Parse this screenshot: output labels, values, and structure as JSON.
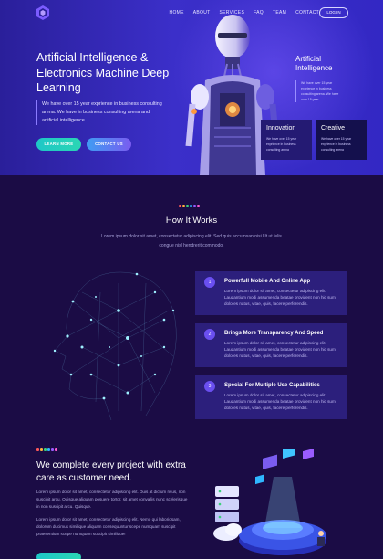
{
  "nav": {
    "items": [
      "HOME",
      "ABOUT",
      "SERVICES",
      "FAQ",
      "TEAM",
      "CONTACT"
    ],
    "login": "LOG IN"
  },
  "hero": {
    "title": "Artificial Intelligence & Electronics Machine Deep Learning",
    "description": "We have over 15 year exprience in business consulting arena. We have in business consulting arena and artificial intelligence.",
    "learn_more": "LEARN MORE",
    "contact_us": "CONTACT US"
  },
  "ai_panel": {
    "title": "Artificial Intelligence",
    "description": "We have over 15 year exprience in business consulting arena. We have over 15 year"
  },
  "features": [
    {
      "title": "Innovation",
      "description": "We have over 15 year exprience in business consulting arena"
    },
    {
      "title": "Creative",
      "description": "We have over 15 year exprience in business consulting arena"
    }
  ],
  "how": {
    "title": "How It Works",
    "subtitle": "Lorem ipsum dolor sit amet, consectetur adipiscing elit. Sed quis accumsan nisi Ut ut felis congue nisl hendrerit commodo.",
    "steps": [
      {
        "number": "1",
        "title": "Powerfull Mobile And Online App",
        "description": "Lorem ipsum dolor sit amet, consectetur adipiscing elit. Laudantium modi assumenda beatae provident non hic sum dolores natus, vitae, quis, facere perferendis."
      },
      {
        "number": "2",
        "title": "Brings More Transparency And Speed",
        "description": "Lorem ipsum dolor sit amet, consectetur adipiscing elit. Laudantium modi assumenda beatae provident non hic sum dolores natus, vitae, quis, facere perferendis."
      },
      {
        "number": "3",
        "title": "Special For Multiple Use Capabilities",
        "description": "Lorem ipsum dolor sit amet, consectetur adipiscing elit. Laudantium modi assumenda beatae provident non hic sum dolores natus, vitae, quis, facere perferendis."
      }
    ]
  },
  "bottom": {
    "title": "We complete every project with extra care as customer need.",
    "paragraph1": "Lorem ipsum dolor sit amet, consectetur adipiscing elit. Duis at dictum risus, non suscipit arcu. Quisque aliquam posuere tortor, sit amet convallis nunc scelerisque in non suscipit arcu. Quisque.",
    "paragraph2": "Lorem ipsum dolor sit amet, consectetur adipiscing elit. Nemo qui laboriosam, dolorum ducimus similique aliquam consequuntur scepe numquam suscipit praesentium scepe numquam suscipit similique!"
  },
  "colors": {
    "dots": [
      "#ff5a5a",
      "#ffb340",
      "#3ad17a",
      "#2fb7ff",
      "#9a5cff",
      "#ff5ad1"
    ]
  }
}
